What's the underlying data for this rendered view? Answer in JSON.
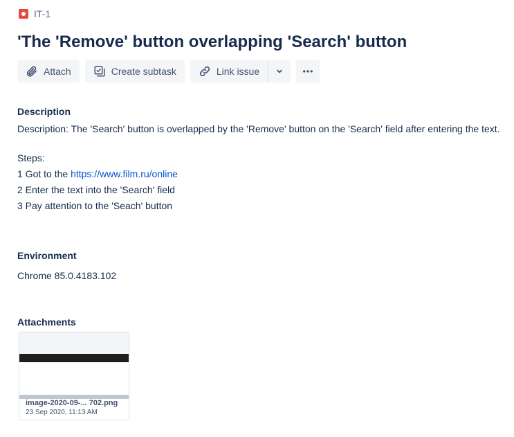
{
  "issue": {
    "key": "IT-1",
    "title": "'The 'Remove' button overlapping 'Search' button"
  },
  "toolbar": {
    "attach": "Attach",
    "create_subtask": "Create subtask",
    "link_issue": "Link issue"
  },
  "description": {
    "heading": "Description",
    "line1": "Description: The 'Search' button is overlapped by the 'Remove' button on the  'Search' field after entering the text.",
    "steps_label": "Steps:",
    "step1_prefix": "1 Got to the ",
    "step1_link": "https://www.film.ru/online",
    "step2": "2 Enter the text into the 'Search' field",
    "step3": "3 Pay attention to the 'Seach' button"
  },
  "environment": {
    "heading": "Environment",
    "value": "Chrome 85.0.4183.102"
  },
  "attachments": {
    "heading": "Attachments",
    "items": [
      {
        "name": "image-2020-09-... 702.png",
        "date": "23 Sep 2020, 11:13 AM"
      }
    ]
  },
  "icons": {
    "issue_type": "bug-icon",
    "attach": "paperclip-icon",
    "subtask": "subtask-icon",
    "link": "link-icon",
    "dropdown": "chevron-down-icon",
    "more": "more-icon"
  },
  "colors": {
    "bug": "#e5493a",
    "link": "#0052cc",
    "button_bg": "#f4f5f7",
    "text": "#172b4d"
  }
}
